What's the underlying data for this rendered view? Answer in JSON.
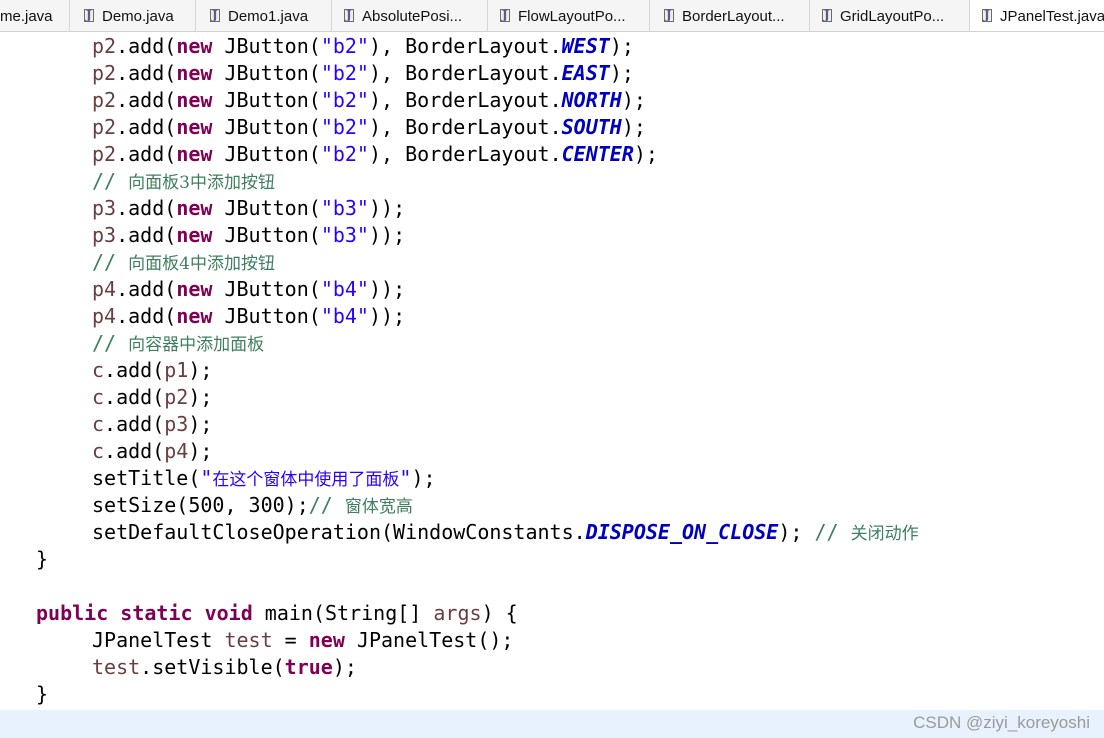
{
  "tabs": [
    {
      "label": "me.java",
      "icon": "none",
      "active": false
    },
    {
      "label": "Demo.java",
      "icon": "java-file-icon",
      "active": false
    },
    {
      "label": "Demo1.java",
      "icon": "java-file-icon",
      "active": false
    },
    {
      "label": "AbsolutePosi...",
      "icon": "java-file-icon",
      "active": false
    },
    {
      "label": "FlowLayoutPo...",
      "icon": "java-file-icon",
      "active": false
    },
    {
      "label": "BorderLayout...",
      "icon": "java-file-icon",
      "active": false
    },
    {
      "label": "GridLayoutPo...",
      "icon": "java-file-icon",
      "active": false
    },
    {
      "label": "JPanelTest.java",
      "icon": "java-file-icon",
      "active": true
    }
  ],
  "code": {
    "l0": {
      "a": "p2",
      "b": ".add(",
      "c": "new",
      "d": " JButton(",
      "e": "\"b2\"",
      "f": "), BorderLayout.",
      "g": "WEST",
      "h": ");"
    },
    "l1": {
      "a": "p2",
      "b": ".add(",
      "c": "new",
      "d": " JButton(",
      "e": "\"b2\"",
      "f": "), BorderLayout.",
      "g": "EAST",
      "h": ");"
    },
    "l2": {
      "a": "p2",
      "b": ".add(",
      "c": "new",
      "d": " JButton(",
      "e": "\"b2\"",
      "f": "), BorderLayout.",
      "g": "NORTH",
      "h": ");"
    },
    "l3": {
      "a": "p2",
      "b": ".add(",
      "c": "new",
      "d": " JButton(",
      "e": "\"b2\"",
      "f": "), BorderLayout.",
      "g": "SOUTH",
      "h": ");"
    },
    "l4": {
      "a": "p2",
      "b": ".add(",
      "c": "new",
      "d": " JButton(",
      "e": "\"b2\"",
      "f": "), BorderLayout.",
      "g": "CENTER",
      "h": ");"
    },
    "l5": {
      "a": "// ",
      "b": "向面板3中添加按钮"
    },
    "l6": {
      "a": "p3",
      "b": ".add(",
      "c": "new",
      "d": " JButton(",
      "e": "\"b3\"",
      "f": "));"
    },
    "l7": {
      "a": "p3",
      "b": ".add(",
      "c": "new",
      "d": " JButton(",
      "e": "\"b3\"",
      "f": "));"
    },
    "l8": {
      "a": "// ",
      "b": "向面板4中添加按钮"
    },
    "l9": {
      "a": "p4",
      "b": ".add(",
      "c": "new",
      "d": " JButton(",
      "e": "\"b4\"",
      "f": "));"
    },
    "l10": {
      "a": "p4",
      "b": ".add(",
      "c": "new",
      "d": " JButton(",
      "e": "\"b4\"",
      "f": "));"
    },
    "l11": {
      "a": "// ",
      "b": "向容器中添加面板"
    },
    "l12": {
      "a": "c",
      "b": ".add(",
      "c": "p1",
      "d": ");"
    },
    "l13": {
      "a": "c",
      "b": ".add(",
      "c": "p2",
      "d": ");"
    },
    "l14": {
      "a": "c",
      "b": ".add(",
      "c": "p3",
      "d": ");"
    },
    "l15": {
      "a": "c",
      "b": ".add(",
      "c": "p4",
      "d": ");"
    },
    "l16": {
      "a": "setTitle(",
      "b": "\"",
      "c": "在这个窗体中使用了面板",
      "d": "\"",
      "e": ");"
    },
    "l17": {
      "a": "setSize(500, 300);",
      "b": "// ",
      "c": "窗体宽高"
    },
    "l18": {
      "a": "setDefaultCloseOperation(WindowConstants.",
      "b": "DISPOSE_ON_CLOSE",
      "c": "); ",
      "d": "// ",
      "e": "关闭动作"
    },
    "l19": {
      "a": "}"
    },
    "l21": {
      "a": "public",
      "b": " ",
      "c": "static",
      "d": " ",
      "e": "void",
      "f": " main(String[] ",
      "g": "args",
      "h": ") {"
    },
    "l22": {
      "a": "JPanelTest ",
      "b": "test",
      "c": " = ",
      "d": "new",
      "e": " JPanelTest();"
    },
    "l23": {
      "a": "test",
      "b": ".setVisible(",
      "c": "true",
      "d": ");"
    },
    "l24": {
      "a": "}"
    }
  },
  "watermark": "CSDN @ziyi_koreyoshi",
  "colors": {
    "keyword": "#7f0055",
    "string": "#2a00ff",
    "comment": "#3f7f5f",
    "constant": "#0000c0",
    "field": "#6a3e3e",
    "status_bar": "#e8f2fe"
  }
}
